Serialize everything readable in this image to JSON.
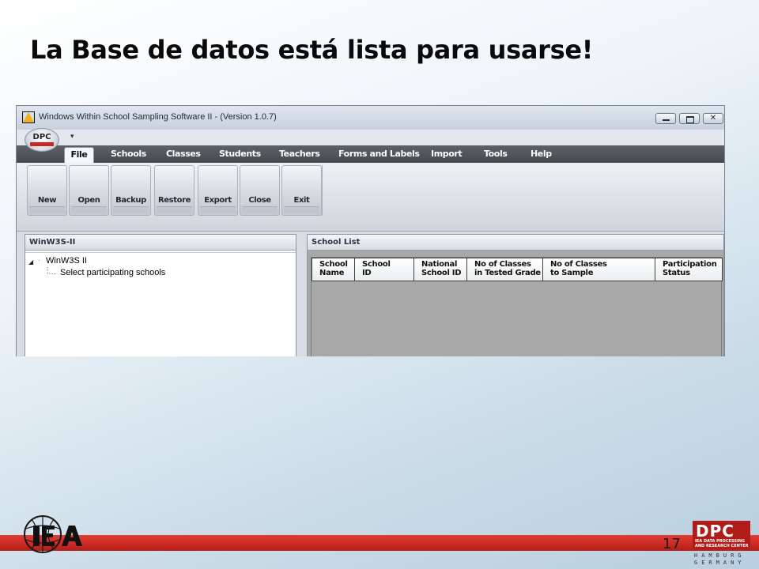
{
  "slide": {
    "title": "La Base de datos está lista para usarse!",
    "page_number": "17"
  },
  "window": {
    "title": "Windows Within School Sampling Software II - (Version 1.0.7)",
    "orb_label": "DPC"
  },
  "menu": {
    "items": [
      {
        "label": "File",
        "active": true
      },
      {
        "label": "Schools"
      },
      {
        "label": "Classes"
      },
      {
        "label": "Students"
      },
      {
        "label": "Teachers"
      },
      {
        "label": "Forms and Labels"
      },
      {
        "label": "Import"
      },
      {
        "label": "Tools"
      },
      {
        "label": "Help"
      }
    ]
  },
  "ribbon": {
    "buttons": [
      "New",
      "Open",
      "Backup",
      "Restore",
      "Export",
      "Close",
      "Exit"
    ]
  },
  "left_pane": {
    "header": "WinW3S-II",
    "tree_root": "WinW3S II",
    "tree_child": "Select participating schools"
  },
  "right_pane": {
    "header": "School List",
    "columns": [
      {
        "line1": "School",
        "line2": "Name"
      },
      {
        "line1": "School",
        "line2": "ID"
      },
      {
        "line1": "National",
        "line2": "School ID"
      },
      {
        "line1": "No of Classes",
        "line2": "in Tested Grade"
      },
      {
        "line1": "No of Classes",
        "line2": "to Sample"
      },
      {
        "line1": "Participation",
        "line2": "Status"
      }
    ]
  },
  "logos": {
    "iea": "IEA",
    "dpc": {
      "letters": "DPC",
      "line1": "IEA DATA PROCESSING",
      "line2": "AND RESEARCH CENTER",
      "city1": "HAMBURG",
      "city2": "GERMANY"
    }
  },
  "colors": {
    "accent_red": "#c42a22",
    "menubar": "#505459",
    "grid_background": "#a8a8a8"
  }
}
